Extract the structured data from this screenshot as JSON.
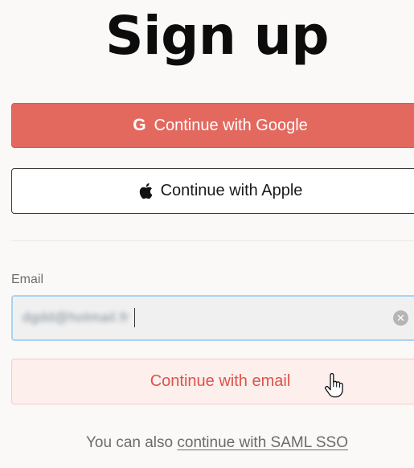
{
  "page": {
    "title": "Sign up"
  },
  "google_button": {
    "icon": "G",
    "label": "Continue with Google"
  },
  "apple_button": {
    "icon": "apple-icon",
    "label": "Continue with Apple"
  },
  "email": {
    "label": "Email",
    "value": "dgdd@hotmail.fr",
    "clear_icon": "✕"
  },
  "email_button": {
    "label": "Continue with email"
  },
  "footer": {
    "prefix": "You can also ",
    "link_label": "continue with SAML SSO"
  },
  "colors": {
    "google_red": "#e3695f",
    "email_button_text": "#e0514a",
    "focus_border": "#a9d3f3"
  }
}
